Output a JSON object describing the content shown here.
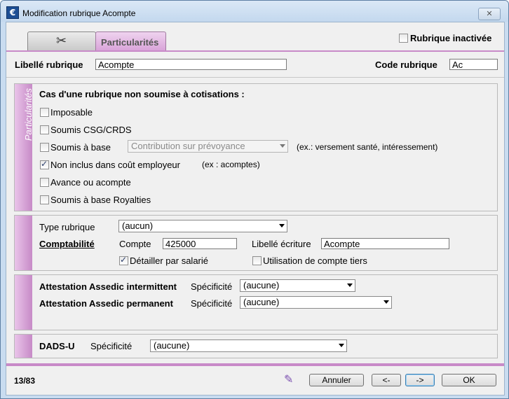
{
  "window": {
    "title": "Modification rubrique Acompte",
    "app_icon": "€",
    "close_label": "✕"
  },
  "tabs": {
    "icon_tab_icon": "tools-icon",
    "particularites": "Particularités"
  },
  "rubrique_inactivee": {
    "label": "Rubrique inactivée",
    "checked": false
  },
  "libelle": {
    "label": "Libellé rubrique",
    "value": "Acompte"
  },
  "code": {
    "label": "Code rubrique",
    "value": "Ac"
  },
  "cotisations": {
    "side_label": "Particularités",
    "heading": "Cas d'une rubrique non soumise à cotisations :",
    "imposable": "Imposable",
    "csg": "Soumis CSG/CRDS",
    "soumis_base": "Soumis à base",
    "base_select": "Contribution sur prévoyance",
    "base_hint": "(ex.: versement santé, intéressement)",
    "non_inclus": "Non inclus dans coût employeur",
    "non_inclus_hint": "(ex : acomptes)",
    "avance": "Avance ou acompte",
    "royalties": "Soumis à base Royalties"
  },
  "compta": {
    "type_label": "Type rubrique",
    "type_value": "(aucun)",
    "comptabilite": "Comptabilité",
    "compte_label": "Compte",
    "compte_value": "425000",
    "libelle_ecriture_label": "Libellé écriture",
    "libelle_ecriture_value": "Acompte",
    "detailler": "Détailler par salarié",
    "tiers": "Utilisation de compte tiers"
  },
  "assedic": {
    "intermittent": "Attestation Assedic intermittent",
    "permanent": "Attestation Assedic permanent",
    "specificite": "Spécificité",
    "intermittent_value": "(aucune)",
    "permanent_value": "(aucune)"
  },
  "dads": {
    "label": "DADS-U",
    "specificite": "Spécificité",
    "value": "(aucune)"
  },
  "footer": {
    "counter": "13/83",
    "edit_icon": "pencil-icon",
    "annuler": "Annuler",
    "prev": "<-",
    "next": "->",
    "ok": "OK"
  },
  "colors": {
    "accent": "#c88ac8",
    "window_frame": "#c9dcf0"
  }
}
